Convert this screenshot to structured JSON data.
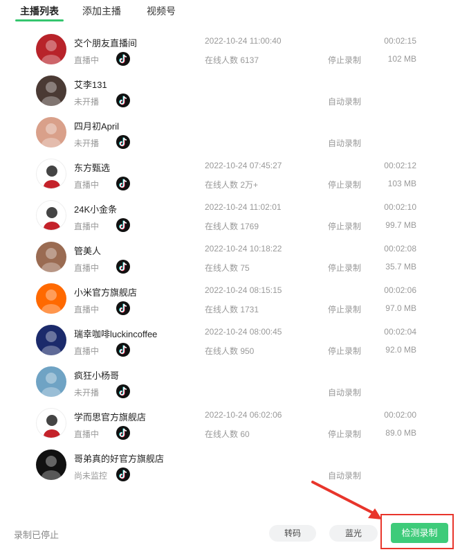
{
  "tabs": [
    {
      "label": "主播列表",
      "active": true
    },
    {
      "label": "添加主播",
      "active": false
    },
    {
      "label": "视频号",
      "active": false
    }
  ],
  "streamers": [
    {
      "name": "交个朋友直播间",
      "status": "直播中",
      "start_time": "2022-10-24 11:00:40",
      "viewers": "在线人数 6137",
      "action": "停止录制",
      "duration": "00:02:15",
      "size": "102 MB",
      "avatar_color": "#b8232a"
    },
    {
      "name": "艾李131",
      "status": "未开播",
      "start_time": "",
      "viewers": "",
      "action": "自动录制",
      "duration": "",
      "size": "",
      "avatar_color": "#4a3a34"
    },
    {
      "name": "四月初April",
      "status": "未开播",
      "start_time": "",
      "viewers": "",
      "action": "自动录制",
      "duration": "",
      "size": "",
      "avatar_color": "#d9a08a"
    },
    {
      "name": "东方甄选",
      "status": "直播中",
      "start_time": "2022-10-24 07:45:27",
      "viewers": "在线人数 2万+",
      "action": "停止录制",
      "duration": "00:02:12",
      "size": "103 MB",
      "avatar_color": "#ffffff"
    },
    {
      "name": "24K小金条",
      "status": "直播中",
      "start_time": "2022-10-24 11:02:01",
      "viewers": "在线人数 1769",
      "action": "停止录制",
      "duration": "00:02:10",
      "size": "99.7 MB",
      "avatar_color": "#ffffff"
    },
    {
      "name": "管美人",
      "status": "直播中",
      "start_time": "2022-10-24 10:18:22",
      "viewers": "在线人数 75",
      "action": "停止录制",
      "duration": "00:02:08",
      "size": "35.7 MB",
      "avatar_color": "#9a6b52"
    },
    {
      "name": "小米官方旗舰店",
      "status": "直播中",
      "start_time": "2022-10-24 08:15:15",
      "viewers": "在线人数 1731",
      "action": "停止录制",
      "duration": "00:02:06",
      "size": "97.0 MB",
      "avatar_color": "#ff6900"
    },
    {
      "name": "瑞幸咖啡luckincoffee",
      "status": "直播中",
      "start_time": "2022-10-24 08:00:45",
      "viewers": "在线人数 950",
      "action": "停止录制",
      "duration": "00:02:04",
      "size": "92.0 MB",
      "avatar_color": "#1b2a6b"
    },
    {
      "name": "疯狂小杨哥",
      "status": "未开播",
      "start_time": "",
      "viewers": "",
      "action": "自动录制",
      "duration": "",
      "size": "",
      "avatar_color": "#6fa3c4"
    },
    {
      "name": "学而思官方旗舰店",
      "status": "直播中",
      "start_time": "2022-10-24 06:02:06",
      "viewers": "在线人数 60",
      "action": "停止录制",
      "duration": "00:02:00",
      "size": "89.0 MB",
      "avatar_color": "#ffffff"
    },
    {
      "name": "哥弟真的好官方旗舰店",
      "status": "尚未监控",
      "start_time": "",
      "viewers": "",
      "action": "自动录制",
      "duration": "",
      "size": "",
      "avatar_color": "#111111"
    }
  ],
  "footer": {
    "status": "录制已停止",
    "transcode_label": "转码",
    "bluray_label": "蓝光",
    "detect_label": "检测录制"
  },
  "colors": {
    "accent": "#35c66e",
    "detect_button": "#3ecb7a",
    "highlight": "#e8352b"
  },
  "icons": {
    "platform": "tiktok-icon",
    "annotation": "red-arrow"
  }
}
